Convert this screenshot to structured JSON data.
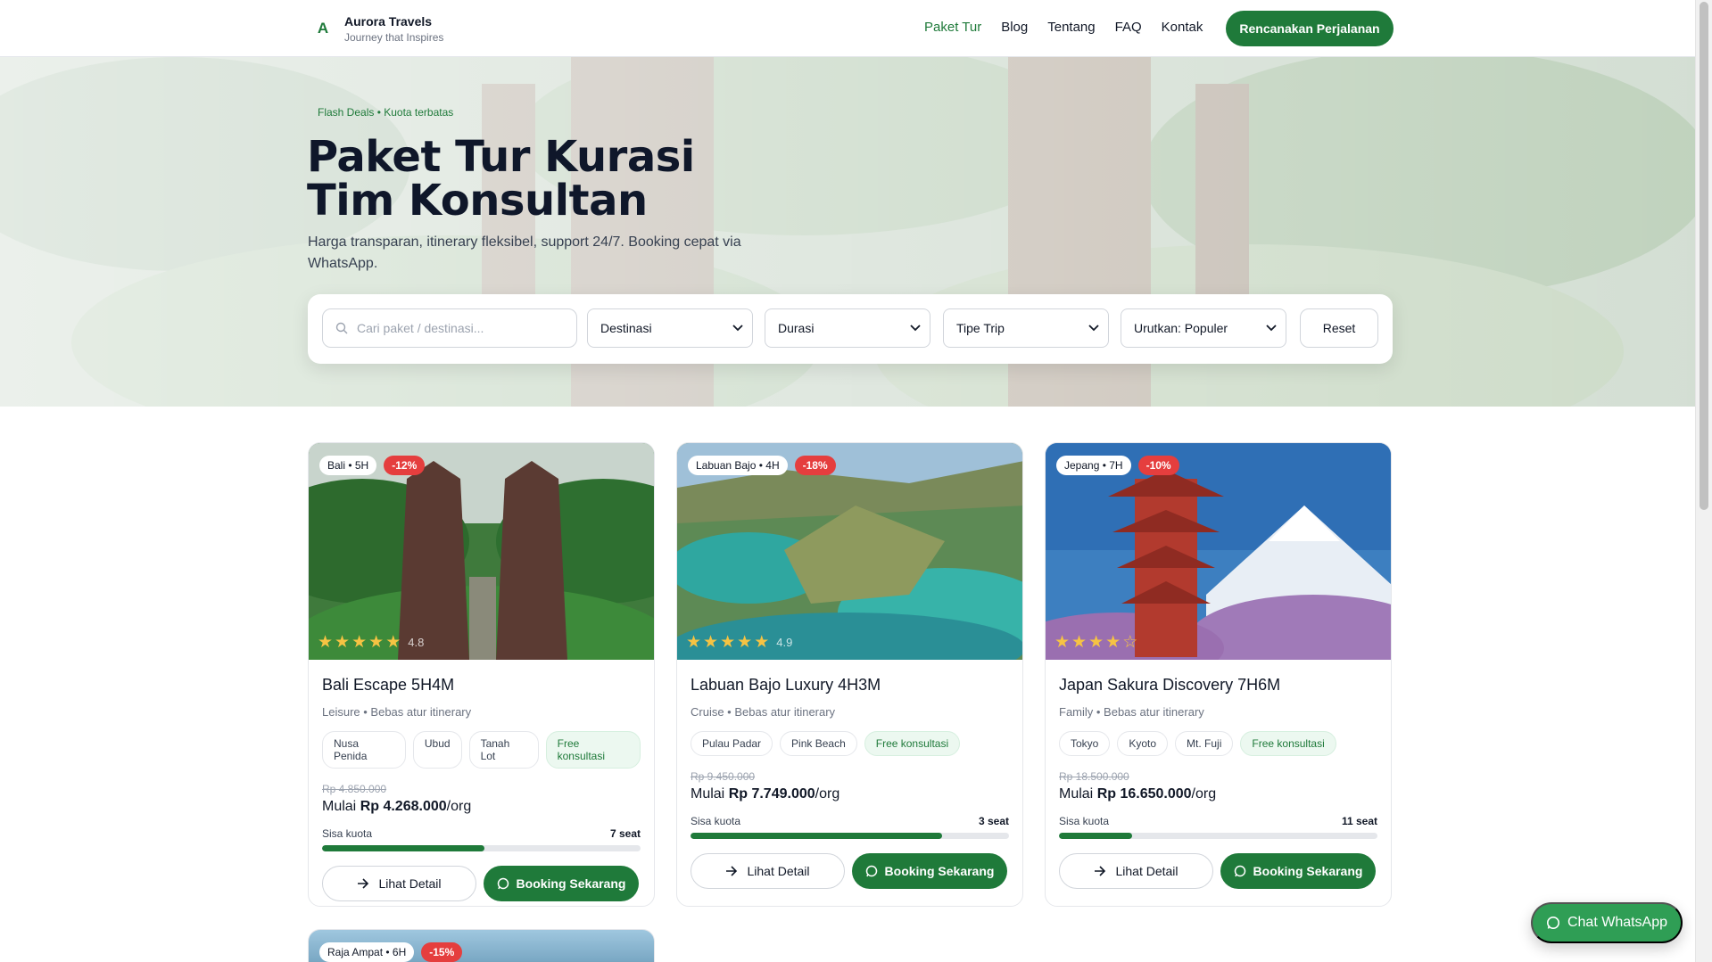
{
  "header": {
    "logo_letter": "A",
    "brand_name": "Aurora Travels",
    "brand_tagline": "Journey that Inspires",
    "nav": [
      {
        "label": "Paket Tur",
        "active": true
      },
      {
        "label": "Blog"
      },
      {
        "label": "Tentang"
      },
      {
        "label": "FAQ"
      },
      {
        "label": "Kontak"
      }
    ],
    "cta_label": "Rencanakan Perjalanan"
  },
  "hero": {
    "eyebrow": "Flash Deals • Kuota terbatas",
    "title_line1": "Paket Tur Kurasi",
    "title_line2": "Tim Konsultan",
    "subtitle": "Harga transparan, itinerary fleksibel, support 24/7. Booking cepat via WhatsApp."
  },
  "filters": {
    "search_placeholder": "Cari paket / destinasi...",
    "destinasi": "Destinasi",
    "durasi": "Durasi",
    "tipe_trip": "Tipe Trip",
    "sort": "Urutkan: Populer",
    "reset_label": "Reset"
  },
  "cards": [
    {
      "location": "Bali • 5H",
      "discount": "-12%",
      "rating": "4.8",
      "stars": 5,
      "title": "Bali Escape 5H4M",
      "meta": "Leisure • Bebas atur itinerary",
      "tags": [
        "Nusa Penida",
        "Ubud",
        "Tanah Lot"
      ],
      "free_tag": "Free konsultasi",
      "old_price": "Rp 4.850.000",
      "price_prefix": "Mulai",
      "price": "Rp 4.268.000",
      "price_suffix": "/org",
      "quota_label": "Sisa kuota",
      "quota_value": "7 seat",
      "quota_fill": 0.51,
      "detail_label": "Lihat Detail",
      "book_label": "Booking Sekarang"
    },
    {
      "location": "Labuan Bajo • 4H",
      "discount": "-18%",
      "rating": "4.9",
      "stars": 5,
      "title": "Labuan Bajo Luxury 4H3M",
      "meta": "Cruise • Bebas atur itinerary",
      "tags": [
        "Pulau Padar",
        "Pink Beach"
      ],
      "free_tag": "Free konsultasi",
      "old_price": "Rp 9.450.000",
      "price_prefix": "Mulai",
      "price": "Rp 7.749.000",
      "price_suffix": "/org",
      "quota_label": "Sisa kuota",
      "quota_value": "3 seat",
      "quota_fill": 0.79,
      "detail_label": "Lihat Detail",
      "book_label": "Booking Sekarang"
    },
    {
      "location": "Jepang • 7H",
      "discount": "-10%",
      "rating": "",
      "stars": 4,
      "title": "Japan Sakura Discovery 7H6M",
      "meta": "Family • Bebas atur itinerary",
      "tags": [
        "Tokyo",
        "Kyoto",
        "Mt. Fuji"
      ],
      "free_tag": "Free konsultasi",
      "old_price": "Rp 18.500.000",
      "price_prefix": "Mulai",
      "price": "Rp 16.650.000",
      "price_suffix": "/org",
      "quota_label": "Sisa kuota",
      "quota_value": "11 seat",
      "quota_fill": 0.23,
      "detail_label": "Lihat Detail",
      "book_label": "Booking Sekarang"
    }
  ],
  "card4": {
    "location": "Raja Ampat • 6H",
    "discount": "-15%"
  },
  "whatsapp_label": "Chat WhatsApp",
  "colors": {
    "primary": "#1f7a3a",
    "discount": "#e53e3e",
    "star": "#f6c343",
    "whatsapp": "#2f9e55"
  }
}
